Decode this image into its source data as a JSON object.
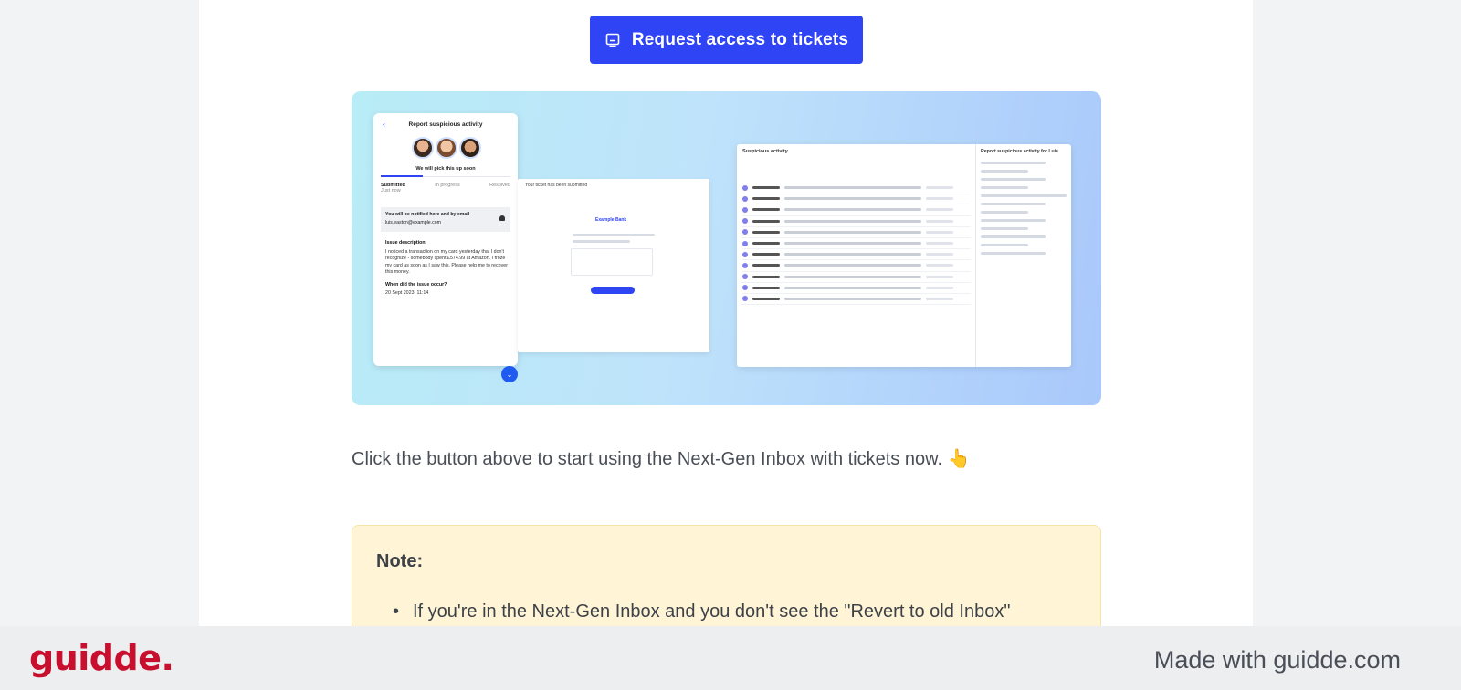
{
  "cta": {
    "label": "Request access to tickets"
  },
  "hero": {
    "mobile": {
      "title": "Report suspicious activity",
      "subtitle": "We will pick this up soon",
      "tabs": [
        "Submitted",
        "In progress",
        "Resolved"
      ],
      "tab_sub": "Just now",
      "notify_title": "You will be notified here and by email",
      "notify_email": "luis.easton@example.com",
      "issue_label": "Issue description",
      "issue_text": "I noticed a transaction on my card yesterday that I don't recognize - somebody spent £574.99 at Amazon. I froze my card as soon as I saw this. Please help me to recover this money.",
      "when_label": "When did the issue occur?",
      "when_value": "20 Sept 2023, 11:14"
    },
    "email": {
      "header": "Your ticket has been submitted",
      "brand": "Example Bank"
    },
    "desktop": {
      "title": "Suspicious activity",
      "side_title": "Report suspicious activity for Luis"
    }
  },
  "caption": {
    "text": "Click the button above to start using the Next-Gen Inbox with tickets now. 👆"
  },
  "note": {
    "title": "Note:",
    "items": [
      "If you're in the Next-Gen Inbox and you don't see the \"Revert to old Inbox\""
    ]
  },
  "footer": {
    "logo": "guidde.",
    "made_with": "Made with guidde.com"
  }
}
